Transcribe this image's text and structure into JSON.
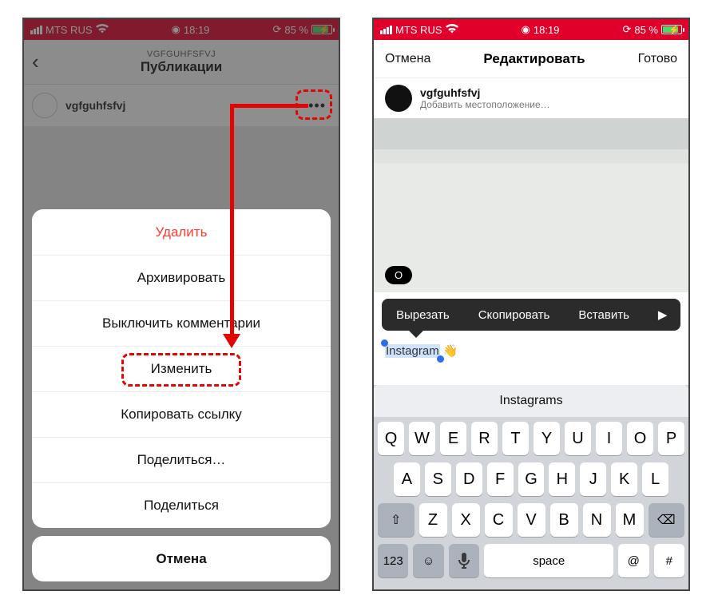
{
  "status": {
    "carrier": "MTS RUS",
    "time": "18:19",
    "battery_pct": "85 %"
  },
  "left": {
    "nav_sub": "VGFGUHFSFVJ",
    "nav_title": "Публикации",
    "username": "vgfguhfsfvj",
    "sheet": {
      "delete": "Удалить",
      "archive": "Архивировать",
      "mute_comments": "Выключить комментарии",
      "edit": "Изменить",
      "copy_link": "Копировать ссылку",
      "share_ellipsis": "Поделиться…",
      "share": "Поделиться",
      "cancel": "Отмена"
    }
  },
  "right": {
    "cancel": "Отмена",
    "title": "Редактировать",
    "done": "Готово",
    "username": "vgfguhfsfvj",
    "add_location": "Добавить местоположение…",
    "tag_pill": "О",
    "edit_menu": {
      "cut": "Вырезать",
      "copy": "Скопировать",
      "paste": "Вставить"
    },
    "selected_text": "Instagram",
    "emoji": "👋",
    "suggestion": "Instagrams",
    "keys_r1": [
      "Q",
      "W",
      "E",
      "R",
      "T",
      "Y",
      "U",
      "I",
      "O",
      "P"
    ],
    "keys_r2": [
      "A",
      "S",
      "D",
      "F",
      "G",
      "H",
      "J",
      "K",
      "L"
    ],
    "keys_r3_mid": [
      "Z",
      "X",
      "C",
      "V",
      "B",
      "N",
      "M"
    ],
    "key_123": "123",
    "key_space": "space",
    "key_at": "@",
    "key_hash": "#"
  }
}
